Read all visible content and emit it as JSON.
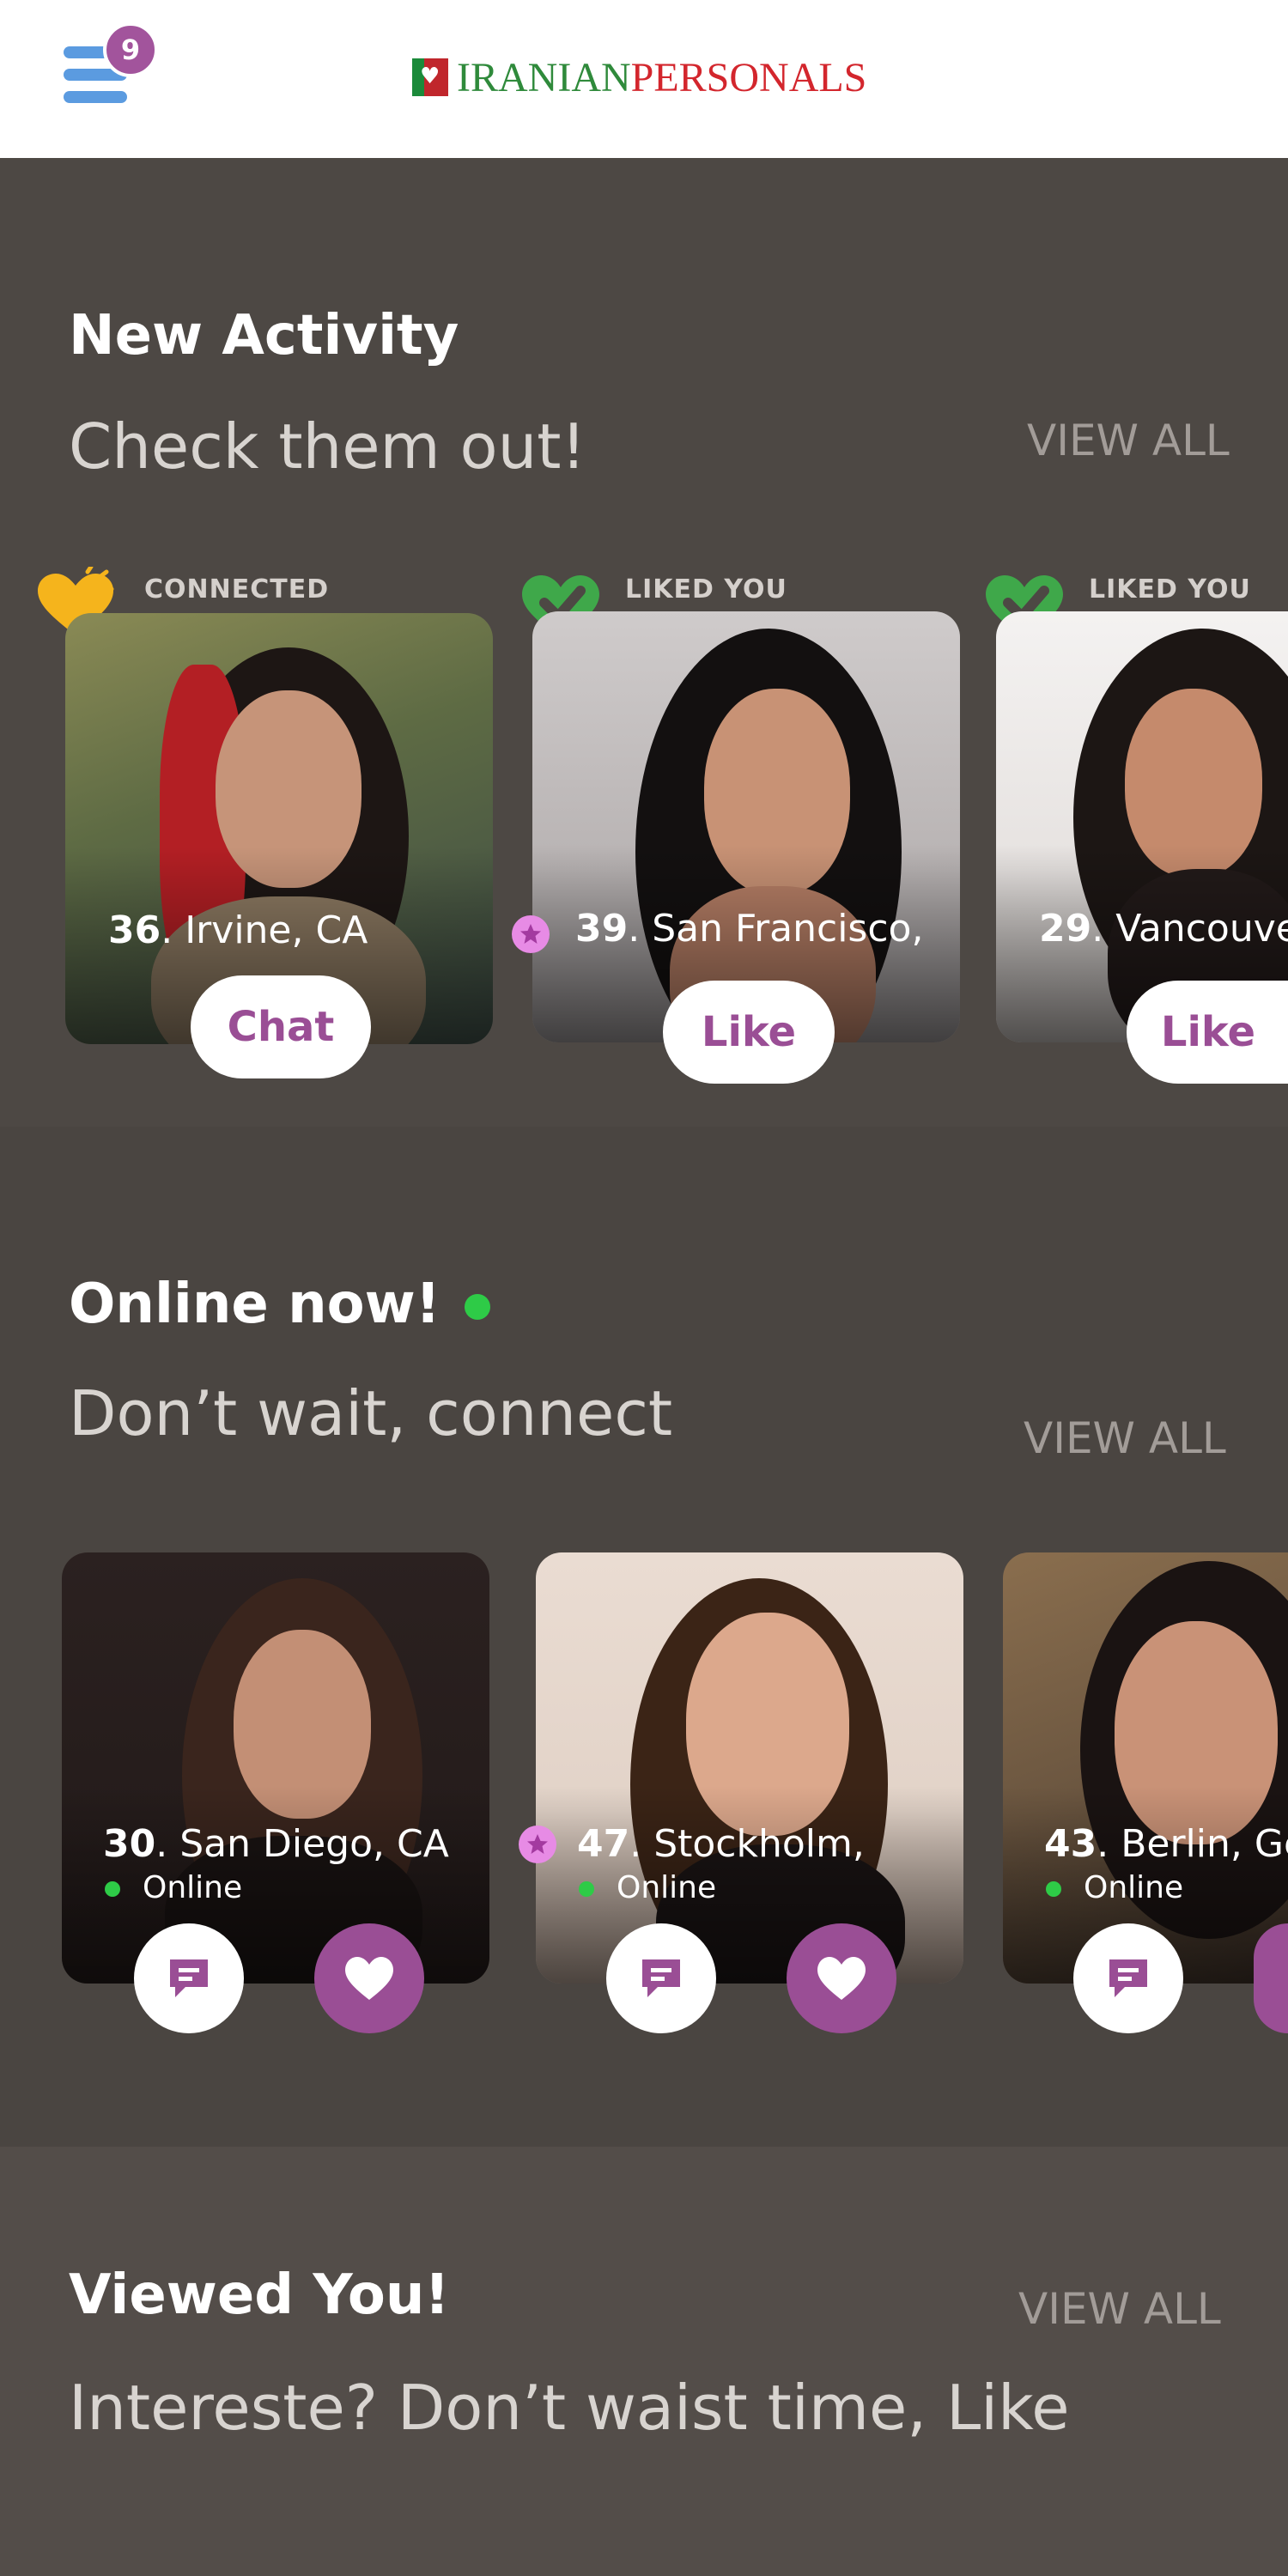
{
  "header": {
    "notification_count": "9",
    "logo_part1": "IRANIAN",
    "logo_part2": "PERSONALS"
  },
  "new_activity": {
    "title": "New Activity",
    "subtitle": "Check them out!",
    "view_all": "VIEW ALL",
    "cards": [
      {
        "tag": "CONNECTED",
        "age": "36",
        "location": ". Irvine, CA",
        "action": "Chat"
      },
      {
        "tag": "LIKED YOU",
        "age": "39",
        "location": ". San Francisco,",
        "action": "Like"
      },
      {
        "tag": "LIKED YOU",
        "age": "29",
        "location": ". Vancouver",
        "action": "Like"
      }
    ]
  },
  "online_now": {
    "title": "Online now!",
    "subtitle": "Don’t wait, connect",
    "view_all": "VIEW ALL",
    "cards": [
      {
        "age": "30",
        "location": ". San Diego, CA",
        "status": "Online"
      },
      {
        "age": "47",
        "location": ". Stockholm,",
        "status": "Online"
      },
      {
        "age": "43",
        "location": ". Berlin, Ge",
        "status": "Online"
      }
    ]
  },
  "viewed_you": {
    "title": "Viewed You!",
    "subtitle": "Intereste? Don’t waist time, Like",
    "view_all": "VIEW ALL"
  },
  "colors": {
    "accent_purple": "#9a4e95",
    "online_green": "#2ecb47",
    "menu_blue": "#5b9be0"
  }
}
